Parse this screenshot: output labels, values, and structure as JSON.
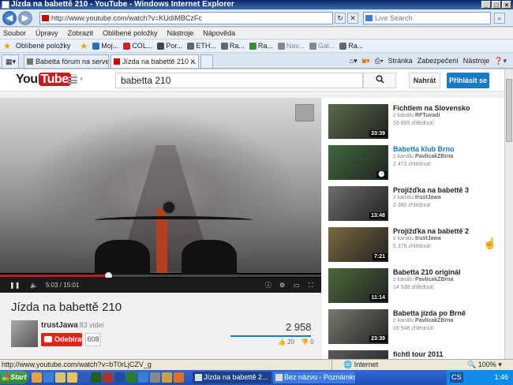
{
  "window": {
    "title": "Jízda na babettě 210 - YouTube - Windows Internet Explorer"
  },
  "address": {
    "url": "http://www.youtube.com/watch?v=KUdIMBCzFc",
    "live_search_placeholder": "Live Search"
  },
  "menu": [
    "Soubor",
    "Úpravy",
    "Zobrazit",
    "Oblíbené položky",
    "Nástroje",
    "Nápověda"
  ],
  "favorites": {
    "label": "Oblíbené položky",
    "items": [
      {
        "label": "Moj...",
        "color": "#2a6ebd"
      },
      {
        "label": "COL...",
        "color": "#c22"
      },
      {
        "label": "Por...",
        "color": "#444"
      },
      {
        "label": "ETH...",
        "color": "#666"
      },
      {
        "label": "Ra...",
        "color": "#666"
      },
      {
        "label": "Ra...",
        "color": "#3a8a3a"
      },
      {
        "label": "Nav...",
        "color": "#888"
      },
      {
        "label": "Gal...",
        "color": "#888"
      },
      {
        "label": "Ra...",
        "color": "#666"
      }
    ]
  },
  "tabs": [
    {
      "label": "Babetta fórum na serveru sp...",
      "active": false
    },
    {
      "label": "Jízda na babettě 210 ...",
      "active": true
    }
  ],
  "tab_tools": {
    "page": "Stránka",
    "security": "Zabezpečení",
    "tools": "Nástroje"
  },
  "youtube": {
    "logo_you": "You",
    "logo_tube": "Tube",
    "logo_cc": "CZ",
    "search_value": "babetta 210",
    "upload": "Nahrát",
    "sign_in": "Přihlásit se"
  },
  "player": {
    "time_current": "5:03",
    "time_total": "15:01",
    "progress_fraction": 0.336
  },
  "video": {
    "title": "Jízda na babettě 210",
    "channel": "trustJawa",
    "channel_videos": "· 83 videí",
    "subscribe": "Odebírat",
    "subscribers": "608",
    "views": "2 958",
    "likes": "20",
    "dislikes": "0",
    "like_ratio": 1.0
  },
  "related": [
    {
      "title": "Fichtlem na Slovensko",
      "channel_prefix": "z kanálu",
      "channel": "RFTuvadi",
      "views": "16 895 zhlédnutí",
      "duration": "33:39",
      "highlight": false,
      "thumb": "#5a6a48"
    },
    {
      "title": "Babetta klub Brno",
      "channel_prefix": "z kanálu",
      "channel": "PavlicakZBrna",
      "views": "2 472 zhlédnutí",
      "duration": "",
      "highlight": true,
      "thumb": "#3f6a3c"
    },
    {
      "title": "Projížďka na babettě 3",
      "channel_prefix": "z kanálu",
      "channel": "trustJawa",
      "views": "2 380 zhlédnutí",
      "duration": "13:48",
      "highlight": false,
      "thumb": "#6d6d6d"
    },
    {
      "title": "Projížďka na babettě 2",
      "channel_prefix": "z kanálu",
      "channel": "trustJawa",
      "views": "5 376 zhlédnutí",
      "duration": "7:21",
      "highlight": false,
      "thumb": "#7a6a40"
    },
    {
      "title": "Babetta 210 originál",
      "channel_prefix": "z kanálu",
      "channel": "PavlicakZBrna",
      "views": "14 538 zhlédnutí",
      "duration": "11:14",
      "highlight": false,
      "thumb": "#4a6a3a"
    },
    {
      "title": "Babetta jízda po Brně",
      "channel_prefix": "z kanálu",
      "channel": "PavlicakZBrna",
      "views": "16 948 zhlédnutí",
      "duration": "23:39",
      "highlight": false,
      "thumb": "#7a7a70"
    },
    {
      "title": "fichtl tour 2011",
      "channel_prefix": "",
      "channel": "",
      "views": "",
      "duration": "",
      "highlight": false,
      "thumb": "#5a5a5a"
    }
  ],
  "status": {
    "url": "http://www.youtube.com/watch?v=bT0rLjCZV_g",
    "zone": "Internet",
    "zoom": "100%"
  },
  "taskbar": {
    "start": "Start",
    "tasks": [
      {
        "label": "Jízda na babettě 2...",
        "active": true
      },
      {
        "label": "Bez názvu - Poznámkový...",
        "active": false
      }
    ],
    "clock": "1:46",
    "tray_lang": "CS"
  }
}
